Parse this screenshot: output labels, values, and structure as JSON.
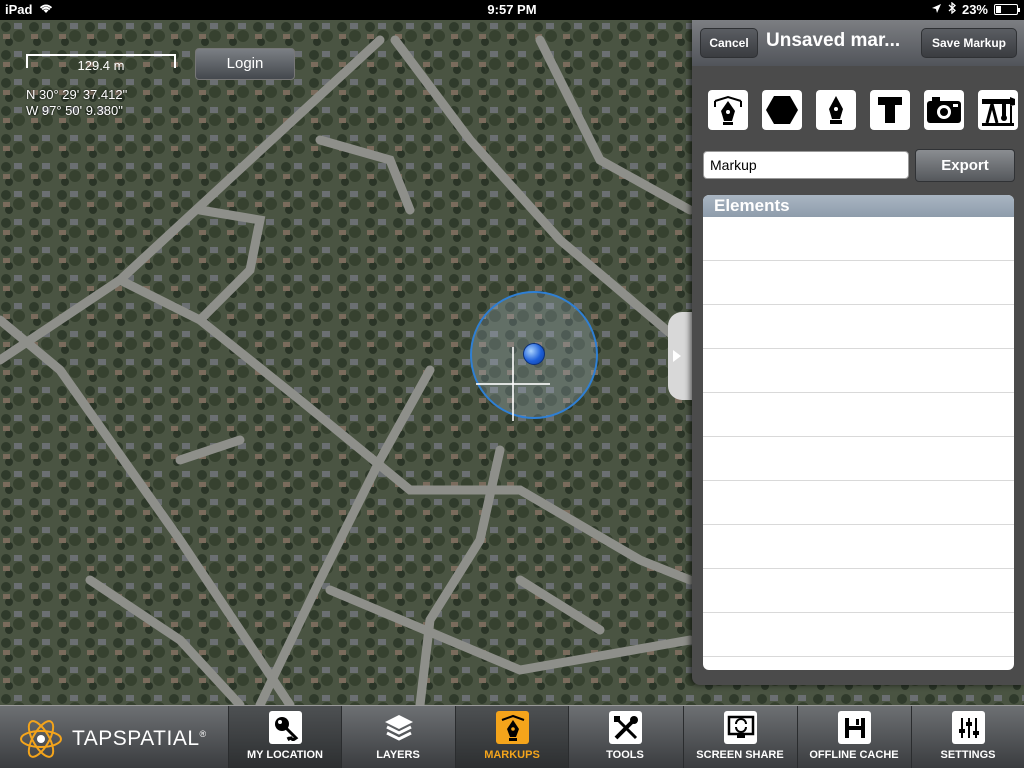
{
  "status_bar": {
    "device": "iPad",
    "time": "9:57 PM",
    "battery": "23%",
    "battery_level": 0.23
  },
  "map": {
    "scale": "129.4 m",
    "latitude": "N 30° 29' 37.412\"",
    "longitude": "W 97° 50' 9.380\"",
    "login_label": "Login"
  },
  "panel": {
    "cancel_label": "Cancel",
    "title": "Unsaved mar...",
    "save_label": "Save Markup",
    "tools": [
      {
        "name": "pen-tool-icon"
      },
      {
        "name": "polygon-tool-icon"
      },
      {
        "name": "line-pen-tool-icon"
      },
      {
        "name": "text-tool-icon"
      },
      {
        "name": "camera-tool-icon"
      },
      {
        "name": "pump-jack-tool-icon"
      }
    ],
    "name_value": "Markup",
    "export_label": "Export",
    "elements_header": "Elements",
    "elements_rows": 10
  },
  "toolbar": {
    "brand": "TAPSPATIAL",
    "brand_mark": "®",
    "accent": "#f4a41b",
    "items": [
      {
        "label": "MY LOCATION",
        "icon": "key-icon"
      },
      {
        "label": "LAYERS",
        "icon": "layers-icon"
      },
      {
        "label": "MARKUPS",
        "icon": "pen-nib-icon"
      },
      {
        "label": "TOOLS",
        "icon": "tools-icon"
      },
      {
        "label": "SCREEN SHARE",
        "icon": "screen-share-icon"
      },
      {
        "label": "OFFLINE CACHE",
        "icon": "disk-icon"
      },
      {
        "label": "SETTINGS",
        "icon": "sliders-icon"
      }
    ]
  }
}
